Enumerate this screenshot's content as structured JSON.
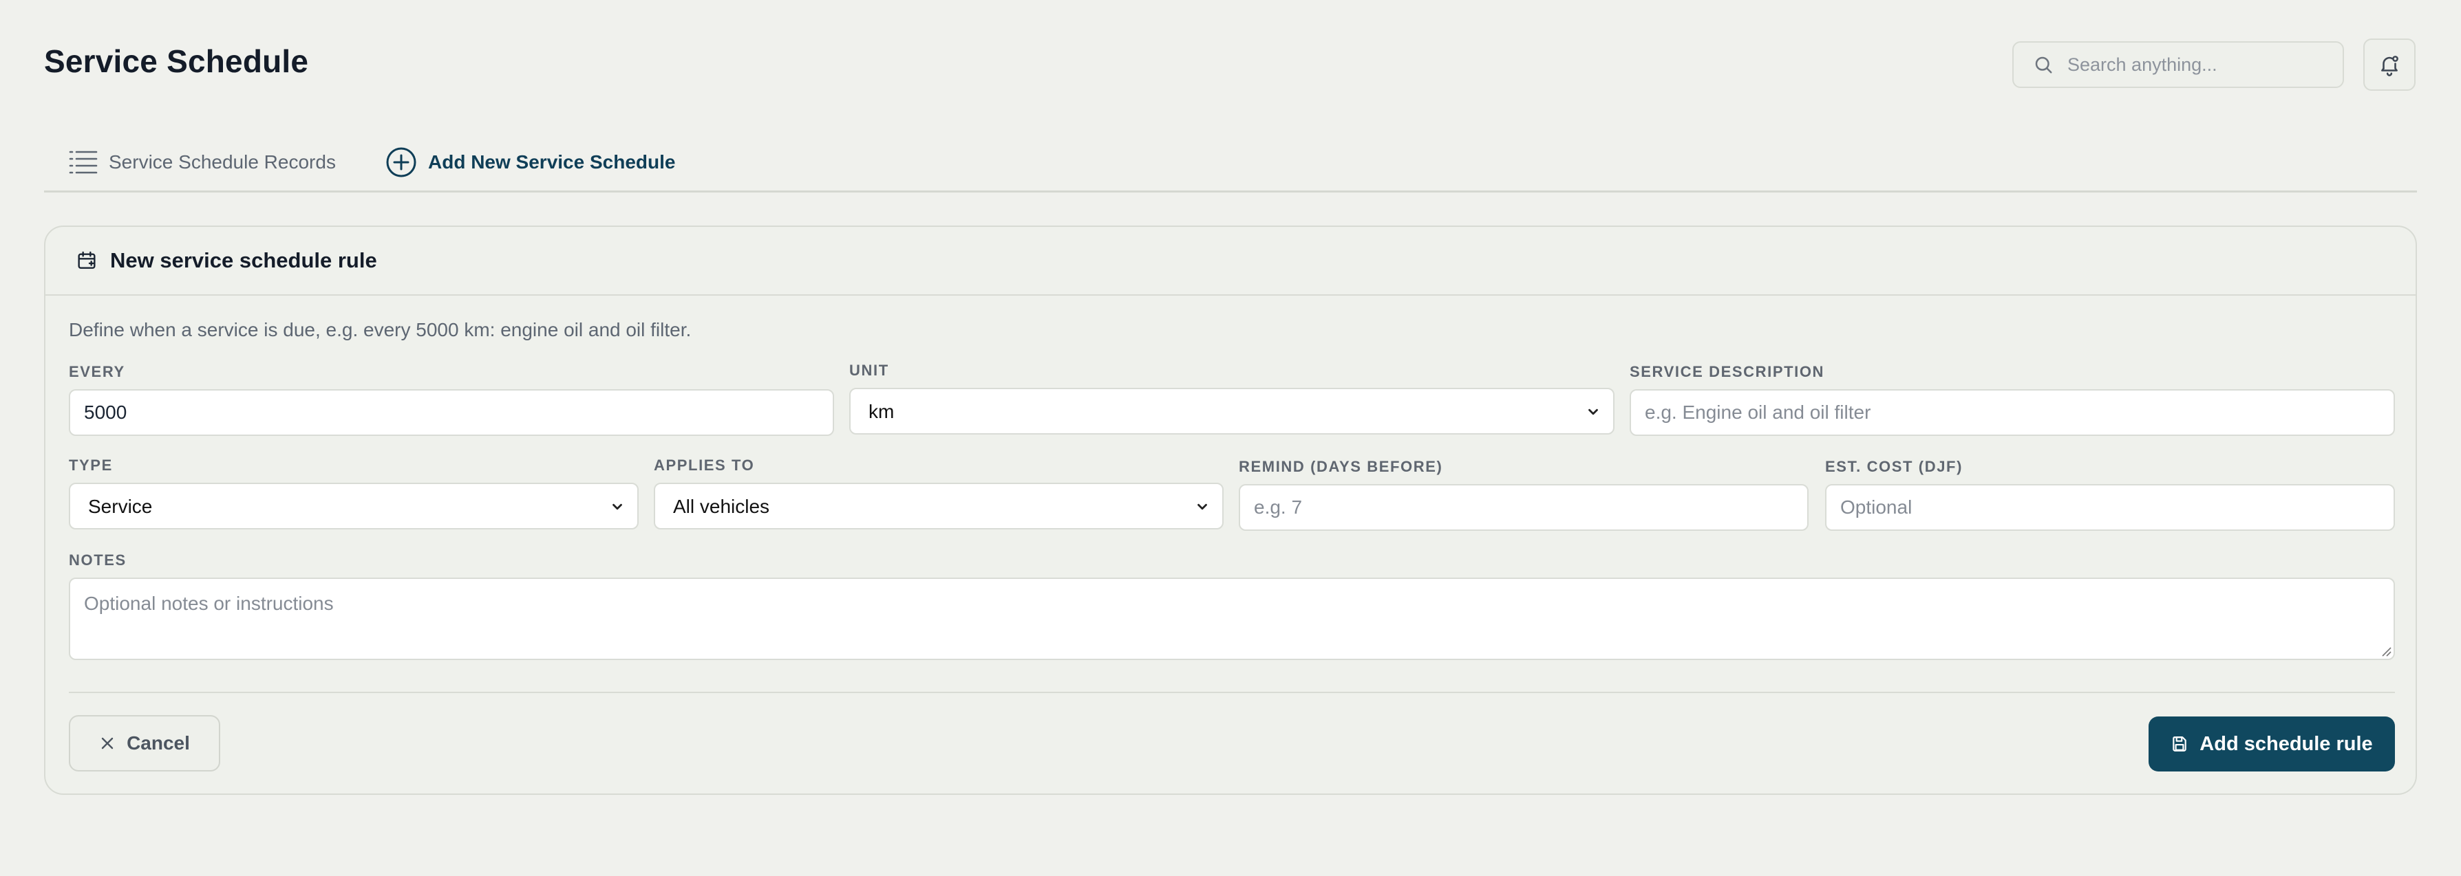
{
  "header": {
    "title": "Service Schedule",
    "search_placeholder": "Search anything...",
    "search_icon": "search-icon",
    "notifications_icon": "bell-icon"
  },
  "tabs": [
    {
      "label": "Service Schedule Records",
      "icon": "list-icon",
      "active": false
    },
    {
      "label": "Add New Service Schedule",
      "icon": "plus-circle-icon",
      "active": true
    }
  ],
  "card": {
    "title": "New service schedule rule",
    "icon": "calendar-plus-icon",
    "description": "Define when a service is due, e.g. every 5000 km: engine oil and oil filter.",
    "fields": {
      "every": {
        "label": "Every",
        "value": "5000"
      },
      "unit": {
        "label": "Unit",
        "value": "km"
      },
      "service_description": {
        "label": "Service description",
        "placeholder": "e.g. Engine oil and oil filter"
      },
      "type": {
        "label": "Type",
        "value": "Service"
      },
      "applies_to": {
        "label": "Applies to",
        "value": "All vehicles"
      },
      "remind": {
        "label": "Remind (days before)",
        "placeholder": "e.g. 7"
      },
      "est_cost": {
        "label": "Est. cost (DJF)",
        "placeholder": "Optional"
      },
      "notes": {
        "label": "Notes",
        "placeholder": "Optional notes or instructions"
      }
    },
    "actions": {
      "cancel_label": "Cancel",
      "submit_label": "Add schedule rule"
    }
  },
  "colors": {
    "background": "#f0f1ed",
    "accent": "#10485f",
    "active_tab": "#0f3e57",
    "muted_text": "#5d6672"
  }
}
